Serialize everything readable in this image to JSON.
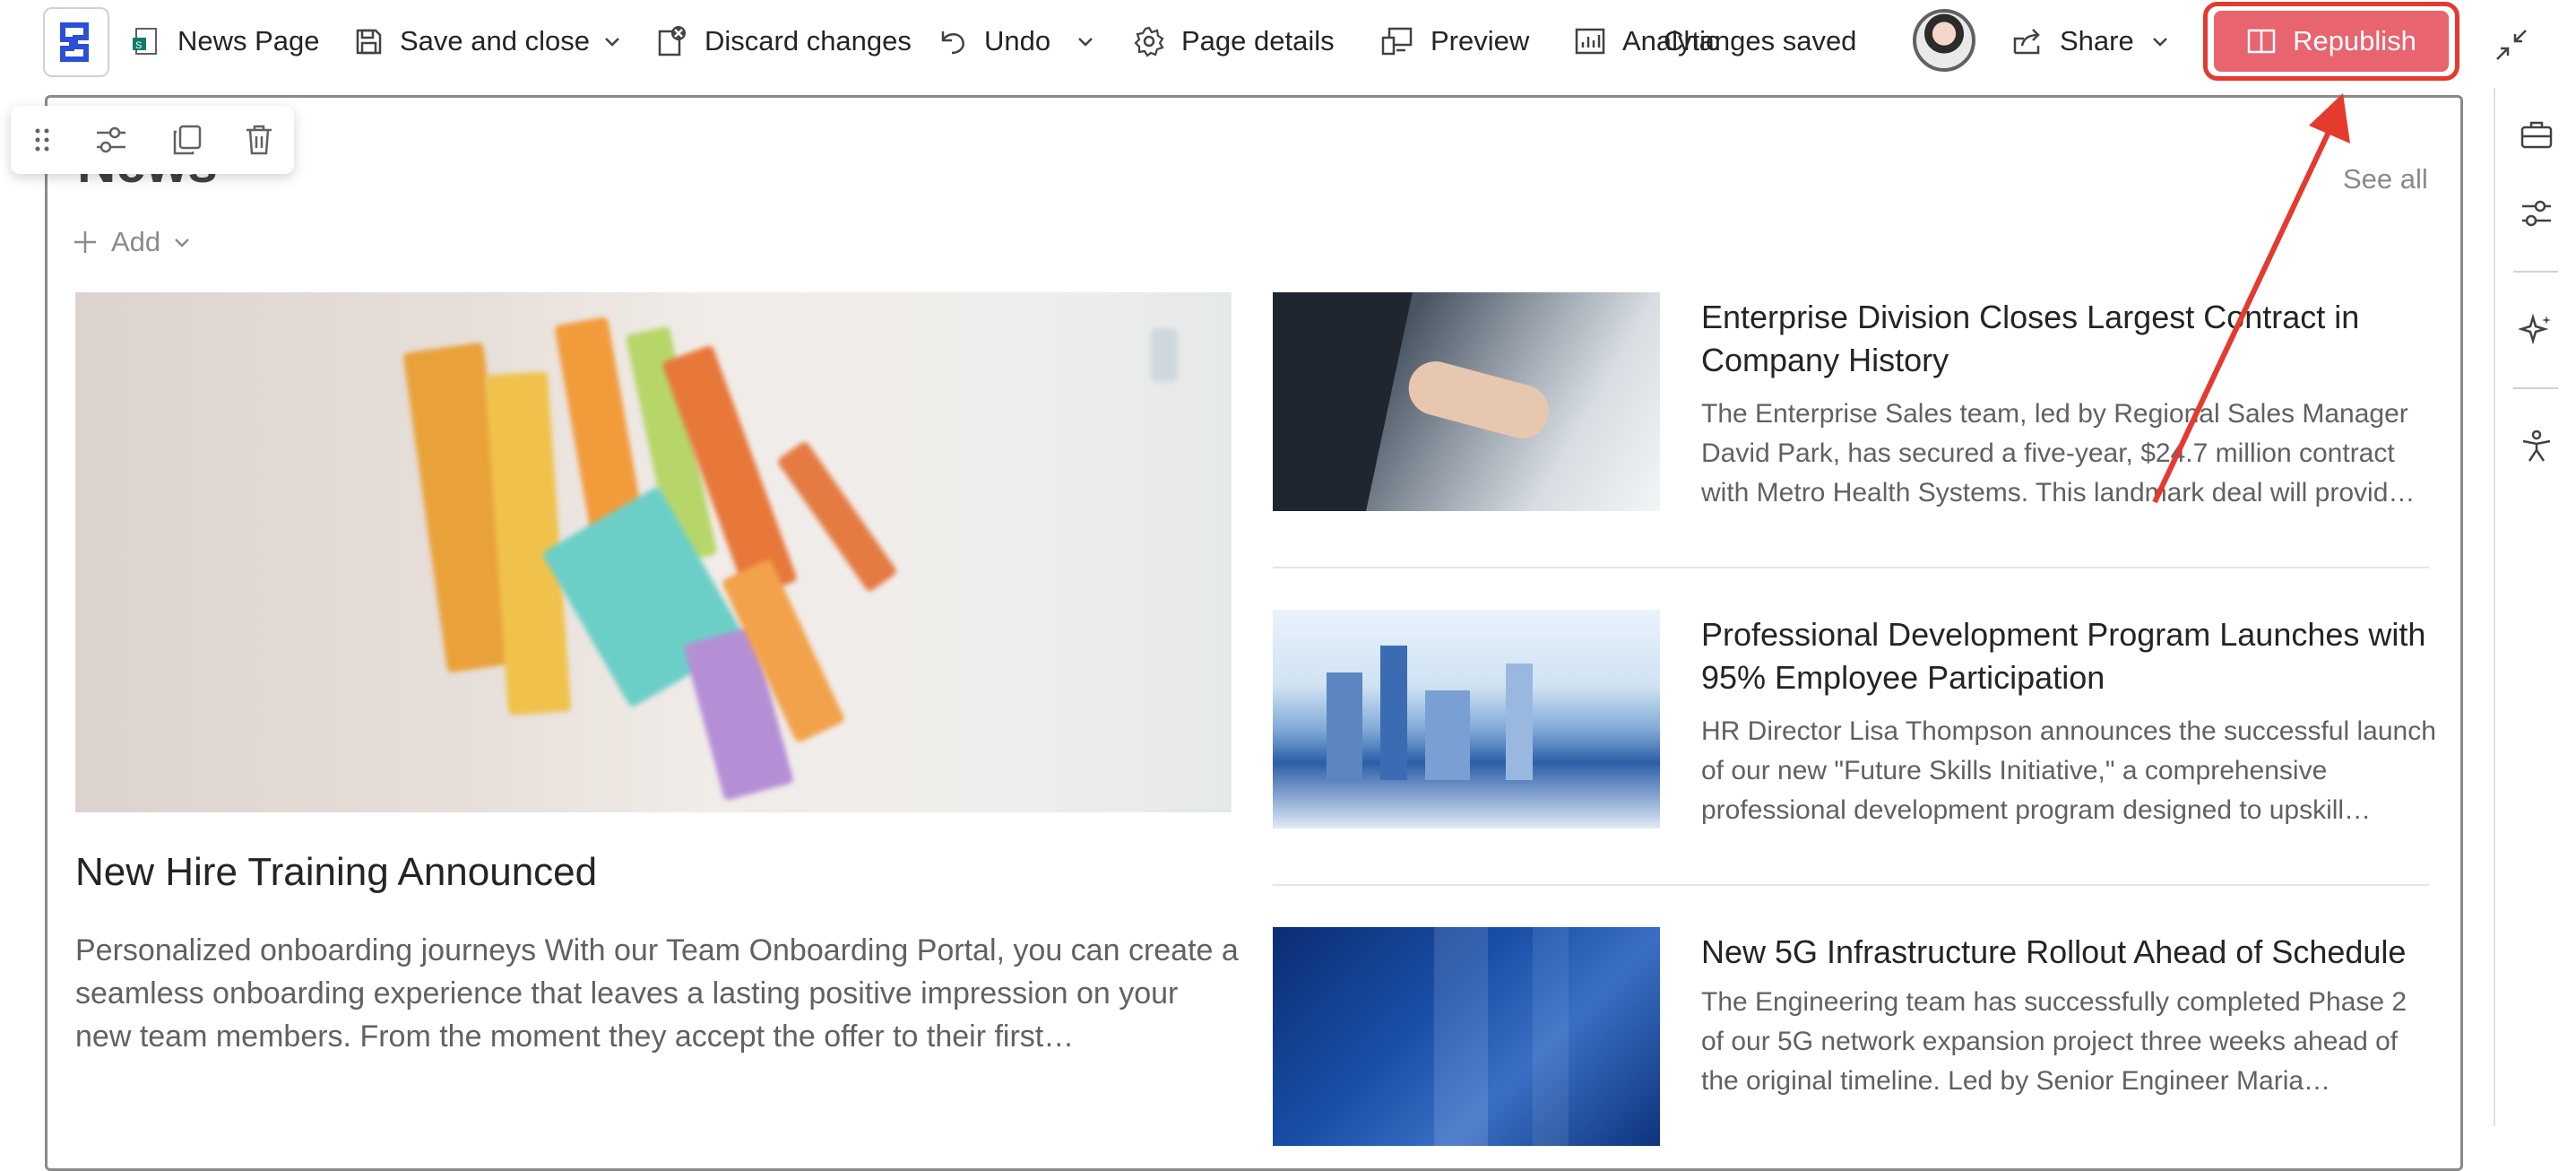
{
  "toolbar": {
    "page_name": "News Page",
    "save_close": "Save and close",
    "discard": "Discard changes",
    "undo": "Undo",
    "page_details": "Page details",
    "preview": "Preview",
    "analytics": "Analytic",
    "changes_saved": "Changes saved",
    "share": "Share",
    "republish": "Republish"
  },
  "news": {
    "title": "News",
    "see_all": "See all",
    "add": "Add",
    "hero": {
      "title": "New Hire Training Announced",
      "desc": "Personalized onboarding journeys With our Team Onboarding Portal, you can create a seamless onboarding experience that leaves a lasting positive impression on your new team members. From the moment they accept the offer to their first…"
    },
    "stories": [
      {
        "title": "Enterprise Division Closes Largest Contract in Company History",
        "desc": "The Enterprise Sales team, led by Regional Sales Manager David Park, has secured a five-year, $24.7 million contract with Metro Health Systems. This landmark deal will provid…"
      },
      {
        "title": "Professional Development Program Launches with 95% Employee Participation",
        "desc": "HR Director Lisa Thompson announces the successful launch of our new \"Future Skills Initiative,\" a comprehensive professional development program designed to upskill…"
      },
      {
        "title": "New 5G Infrastructure Rollout Ahead of Schedule",
        "desc": "The Engineering team has successfully completed Phase 2 of our 5G network expansion project three weeks ahead of the original timeline. Led by Senior Engineer Maria…"
      }
    ]
  },
  "colors": {
    "republish_bg": "#e8646f",
    "annotation": "#e53a2e"
  },
  "icons": [
    "sharepoint-logo-icon",
    "page-icon",
    "save-icon",
    "discard-icon",
    "undo-icon",
    "gear-icon",
    "preview-icon",
    "analytics-icon",
    "share-icon",
    "exit-fullscreen-icon",
    "briefcase-icon",
    "settings-sliders-icon",
    "sparkle-icon",
    "accessibility-icon",
    "drag-handle-icon",
    "edit-properties-icon",
    "duplicate-icon",
    "delete-icon",
    "plus-icon"
  ]
}
